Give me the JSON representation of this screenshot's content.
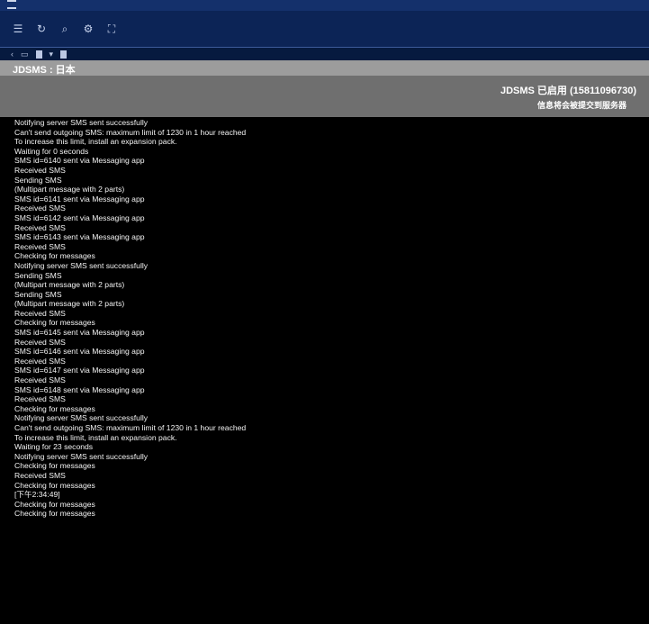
{
  "window": {
    "title": ""
  },
  "toolbar": {
    "icons": [
      "list-icon",
      "refresh-icon",
      "zoom-icon",
      "settings-icon",
      "fullscreen-icon"
    ]
  },
  "tab": {
    "label": "JDSMS : 日本"
  },
  "status": {
    "title": "JDSMS 已启用 (15811096730)",
    "subtitle": "信息将会被提交到服务器"
  },
  "log_lines": [
    "Notifying server SMS sent successfully",
    "Can't send outgoing SMS: maximum limit of 1230 in 1 hour reached",
    "To increase this limit, install an expansion pack.",
    "Waiting for 0 seconds",
    "SMS id=6140 sent via Messaging app",
    "Received SMS",
    "Sending SMS",
    "(Multipart message with 2 parts)",
    "SMS id=6141 sent via Messaging app",
    "Received SMS",
    "SMS id=6142 sent via Messaging app",
    "Received SMS",
    "SMS id=6143 sent via Messaging app",
    "Received SMS",
    "Checking for messages",
    "Notifying server SMS sent successfully",
    "Sending SMS",
    "(Multipart message with 2 parts)",
    "Sending SMS",
    "(Multipart message with 2 parts)",
    "Received SMS",
    "Checking for messages",
    "SMS id=6145 sent via Messaging app",
    "Received SMS",
    "SMS id=6146 sent via Messaging app",
    "Received SMS",
    "SMS id=6147 sent via Messaging app",
    "Received SMS",
    "SMS id=6148 sent via Messaging app",
    "Received SMS",
    "Checking for messages",
    "Notifying server SMS sent successfully",
    "Can't send outgoing SMS: maximum limit of 1230 in 1 hour reached",
    "To increase this limit, install an expansion pack.",
    "Waiting for 23 seconds",
    "Notifying server SMS sent successfully",
    "Checking for messages",
    "Received SMS",
    "Checking for messages",
    "[下午2:34:49]",
    "Checking for messages",
    "Checking for messages"
  ]
}
